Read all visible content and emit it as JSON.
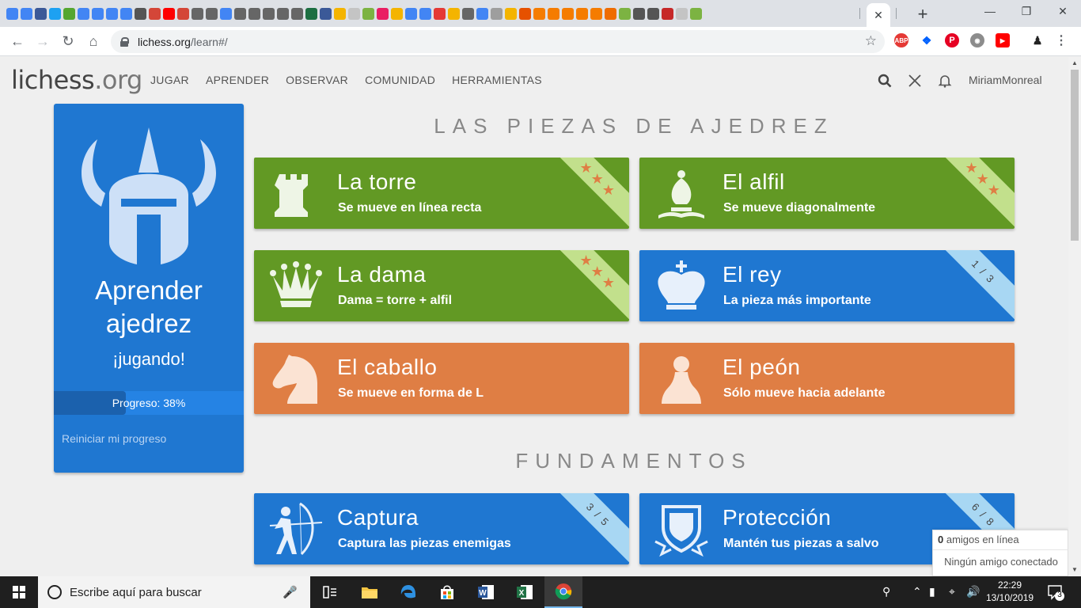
{
  "browser": {
    "active_tab_close": "✕",
    "new_tab": "+",
    "url_host": "lichess.org",
    "url_path": "/learn#/",
    "bookmark_icon": "star-icon",
    "favicon_colors": [
      "#4285f4",
      "#4285f4",
      "#3b5998",
      "#1da1f2",
      "#55a630",
      "#4285f4",
      "#4285f4",
      "#4285f4",
      "#4285f4",
      "#555555",
      "#d44638",
      "#ff0000",
      "#d44638",
      "#666666",
      "#666666",
      "#4285f4",
      "#666666",
      "#666666",
      "#666666",
      "#666666",
      "#666666",
      "#1d6f42",
      "#3b5998",
      "#f4b400",
      "#c4c4c4",
      "#7cb342",
      "#e91e63",
      "#f4b400",
      "#4285f4",
      "#4285f4",
      "#e53935",
      "#f4b400",
      "#666666",
      "#4285f4",
      "#9e9e9e",
      "#f4b400",
      "#e65100",
      "#f57c00",
      "#f57c00",
      "#f57c00",
      "#f57c00",
      "#f57c00",
      "#ef6c00",
      "#7cb342",
      "#555555",
      "#555555",
      "#c62828",
      "#c4c4c4",
      "#7cb342"
    ]
  },
  "site": {
    "logo_main": "lichess",
    "logo_tld": ".org",
    "nav": [
      "JUGAR",
      "APRENDER",
      "OBSERVAR",
      "COMUNIDAD",
      "HERRAMIENTAS"
    ],
    "username": "MiriamMonreal"
  },
  "side": {
    "title": "Aprender ajedrez",
    "subtitle": "¡jugando!",
    "progress_label": "Progreso: 38%",
    "progress_value": 0.38,
    "reset": "Reiniciar mi progreso"
  },
  "sections": [
    {
      "title": "LAS PIEZAS DE AJEDREZ",
      "cards": [
        {
          "title": "La torre",
          "subtitle": "Se mueve en línea recta",
          "color": "green",
          "badge": "stars"
        },
        {
          "title": "El alfil",
          "subtitle": "Se mueve diagonalmente",
          "color": "green",
          "badge": "stars"
        },
        {
          "title": "La dama",
          "subtitle": "Dama = torre + alfil",
          "color": "green",
          "badge": "stars"
        },
        {
          "title": "El rey",
          "subtitle": "La pieza más importante",
          "color": "blue",
          "badge": "1 / 3"
        },
        {
          "title": "El caballo",
          "subtitle": "Se mueve en forma de L",
          "color": "orange",
          "badge": ""
        },
        {
          "title": "El peón",
          "subtitle": "Sólo mueve hacia adelante",
          "color": "orange",
          "badge": ""
        }
      ]
    },
    {
      "title": "FUNDAMENTOS",
      "cards": [
        {
          "title": "Captura",
          "subtitle": "Captura las piezas enemigas",
          "color": "blue",
          "badge": "3 / 5"
        },
        {
          "title": "Protección",
          "subtitle": "Mantén tus piezas a salvo",
          "color": "blue",
          "badge": "6 / 8"
        }
      ]
    }
  ],
  "friends": {
    "count": "0",
    "online_label": "amigos en línea",
    "none": "Ningún amigo conectado"
  },
  "taskbar": {
    "search_placeholder": "Escribe aquí para buscar",
    "time": "22:29",
    "date": "13/10/2019",
    "notifications": "3"
  }
}
